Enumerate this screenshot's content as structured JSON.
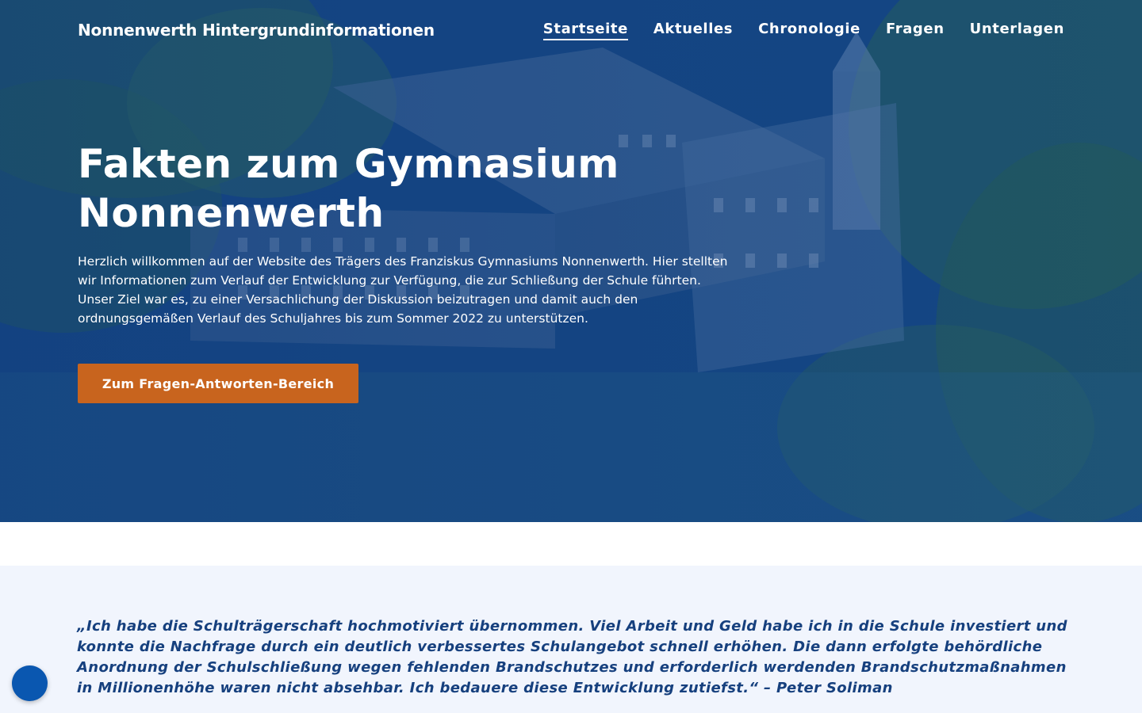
{
  "header": {
    "site_title": "Nonnenwerth Hintergrundinformationen",
    "nav": [
      {
        "label": "Startseite",
        "active": true
      },
      {
        "label": "Aktuelles",
        "active": false
      },
      {
        "label": "Chronologie",
        "active": false
      },
      {
        "label": "Fragen",
        "active": false
      },
      {
        "label": "Unterlagen",
        "active": false
      }
    ]
  },
  "hero": {
    "heading": "Fakten zum Gymnasium Nonnenwerth",
    "intro": "Herzlich willkommen auf der Website des Trägers des Franziskus Gymnasiums Nonnenwerth. Hier stellten wir Informationen zum Verlauf der Entwicklung zur Verfügung, die zur Schließung der Schule führten. Unser Ziel war es, zu einer Versachlichung der Diskussion beizutragen und damit auch den ordnungsgemäßen Verlauf des Schuljahres bis zum Sommer 2022 zu unterstützen.",
    "cta_label": "Zum Fragen-Antworten-Bereich"
  },
  "quote": {
    "text": "„Ich habe die Schulträgerschaft hochmotiviert übernommen. Viel Arbeit und Geld habe ich in die Schule investiert und konnte die Nachfrage durch ein deutlich verbessertes Schulangebot schnell erhöhen. Die dann erfolgte behördliche Anordnung der Schulschließung wegen fehlenden Brandschutzes und erforderlich werdenden Brandschutzmaßnahmen in Millionenhöhe waren nicht absehbar. Ich bedauere diese Entwicklung zutiefst.“ – Peter Soliman"
  },
  "colors": {
    "hero_tint": "#0f3b78",
    "cta_orange": "#c8641e",
    "quote_bg": "#f1f5fd",
    "quote_text": "#16407e",
    "fab_blue": "#0a57b0"
  }
}
